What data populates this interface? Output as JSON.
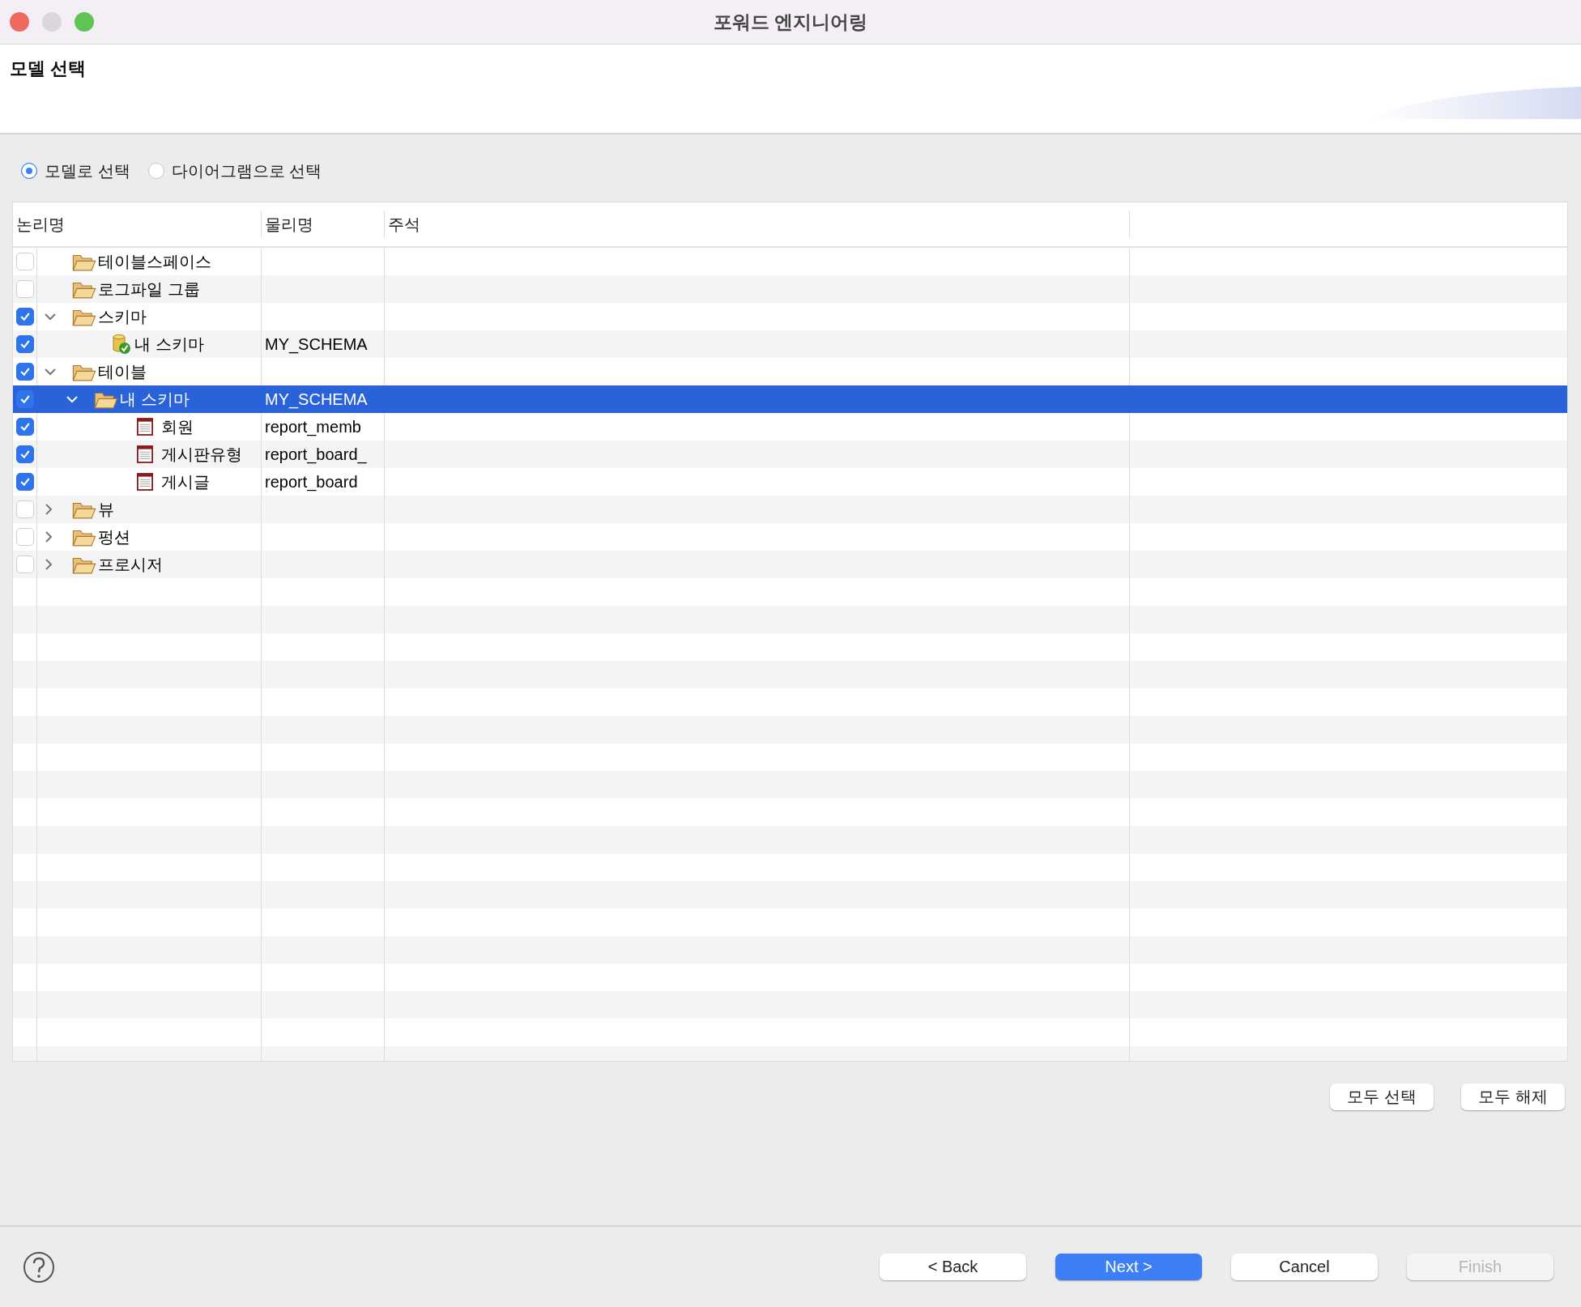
{
  "window": {
    "title": "포워드 엔지니어링"
  },
  "header": {
    "title": "모델 선택"
  },
  "selection_mode": [
    {
      "label": "모델로 선택",
      "selected": true
    },
    {
      "label": "다이어그램으로 선택",
      "selected": false
    }
  ],
  "tree": {
    "columns": [
      "논리명",
      "물리명",
      "주석"
    ],
    "items": [
      {
        "label": "테이블스페이스",
        "kind": "folder",
        "checked": false,
        "selected": false
      },
      {
        "label": "로그파일 그룹",
        "kind": "folder",
        "checked": false,
        "selected": false
      },
      {
        "label": "스키마",
        "kind": "folder",
        "checked": true,
        "expanded": true,
        "selected": false,
        "children": [
          {
            "label": "내 스키마",
            "physical": "MY_SCHEMA",
            "kind": "schema",
            "checked": true,
            "selected": false
          }
        ]
      },
      {
        "label": "테이블",
        "kind": "folder",
        "checked": true,
        "expanded": true,
        "selected": false,
        "children": [
          {
            "label": "내 스키마",
            "physical": "MY_SCHEMA",
            "kind": "folder",
            "checked": true,
            "expanded": true,
            "selected": true,
            "children": [
              {
                "label": "회원",
                "physical": "report_memb",
                "kind": "table",
                "checked": true,
                "selected": false
              },
              {
                "label": "게시판유형",
                "physical": "report_board_",
                "kind": "table",
                "checked": true,
                "selected": false
              },
              {
                "label": "게시글",
                "physical": "report_board",
                "kind": "table",
                "checked": true,
                "selected": false
              }
            ]
          }
        ]
      },
      {
        "label": "뷰",
        "kind": "folder",
        "checked": false,
        "expanded": false,
        "selected": false
      },
      {
        "label": "펑션",
        "kind": "folder",
        "checked": false,
        "expanded": false,
        "selected": false
      },
      {
        "label": "프로시저",
        "kind": "folder",
        "checked": false,
        "expanded": false,
        "selected": false
      }
    ]
  },
  "tree_buttons": [
    "모두 선택",
    "모두 해제"
  ],
  "footer_buttons": [
    {
      "label": "< Back",
      "kind": "normal",
      "disabled": false
    },
    {
      "label": "Next >",
      "kind": "default",
      "disabled": false
    },
    {
      "label": "Cancel",
      "kind": "normal",
      "disabled": false
    },
    {
      "label": "Finish",
      "kind": "normal",
      "disabled": true
    }
  ]
}
